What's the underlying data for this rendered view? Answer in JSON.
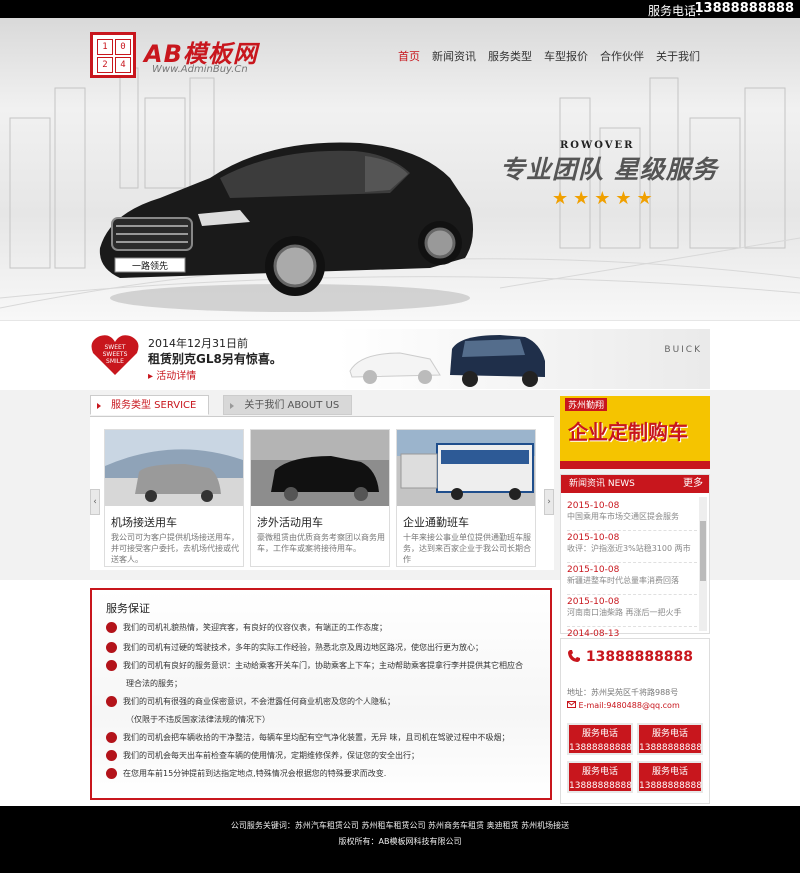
{
  "topbar": {
    "hotline_label": "服务电话：",
    "hotline_number": "13888888888"
  },
  "logo": {
    "digits": [
      "1",
      "0",
      "2",
      "4"
    ],
    "name": "AB模板网",
    "url": "Www.AdminBuy.Cn"
  },
  "nav": {
    "items": [
      "首页",
      "新闻资讯",
      "服务类型",
      "车型报价",
      "合作伙伴",
      "关于我们"
    ]
  },
  "hero": {
    "brand": "ROWOVER",
    "slogan": "专业团队 星级服务",
    "stars": "★★★★★",
    "plate": "一路领先"
  },
  "promo": {
    "heart_line1": "SWEET",
    "heart_line2": "SWEETS",
    "heart_line3": "SMILE",
    "title": "2014年12月31日前",
    "subtitle": "租赁别克GL8另有惊喜。",
    "link": "活动详情",
    "buick": "BUICK"
  },
  "services": {
    "tabs": [
      {
        "label": "服务类型 SERVICE"
      },
      {
        "label": "关于我们 ABOUT US"
      }
    ],
    "prev": "‹",
    "next": "›",
    "cards": [
      {
        "title": "机场接送用车",
        "desc": "我公司可为客户提供机场接送用车，并可接受客户委托，去机场代接或代送客人。"
      },
      {
        "title": "涉外活动用车",
        "desc": "豪微租赁由优质商务考察团以商务用车，工作车或案将接待用车。"
      },
      {
        "title": "企业通勤班车",
        "desc": "十年来接公事业单位提供通勤班车服务，达到来百家企业于我公司长期合作"
      }
    ]
  },
  "ad": {
    "label": "苏州勤翔",
    "main": "企业定制购车"
  },
  "news": {
    "heading": "新闻资讯 NEWS",
    "more": "更多",
    "items": [
      {
        "date": "2015-10-08",
        "title": "中国乘用车市场交通区提会服务"
      },
      {
        "date": "2015-10-08",
        "title": "收评：沪指涨近3%站稳3100 两市"
      },
      {
        "date": "2015-10-08",
        "title": "新疆进整车时代总量率消费回落"
      },
      {
        "date": "2015-10-08",
        "title": "河南南口油柴路 再涨后一把火手"
      },
      {
        "date": "2014-08-13",
        "title": ""
      }
    ]
  },
  "contact": {
    "phone": "13888888888",
    "address": "地址：苏州吴苑区千将路988号",
    "email": "E-mail:9480488@qq.com",
    "buttons": [
      {
        "label": "服务电话",
        "number": "13888888888"
      },
      {
        "label": "服务电话",
        "number": "13888888888"
      },
      {
        "label": "服务电话",
        "number": "13888888888"
      },
      {
        "label": "服务电话",
        "number": "13888888888"
      }
    ]
  },
  "guarantee": {
    "title": "服务保证",
    "items": [
      "我们的司机礼貌热情，笑迎宾客，有良好的仪容仪表，有端正的工作态度；",
      "我们的司机有过硬的驾驶技术，多年的实际工作经验，熟悉北京及周边地区路况，使您出行更为放心；",
      "我们的司机有良好的服务意识：主动给乘客开关车门，协助乘客上下车；主动帮助乘客提拿行李并提供其它相应合",
      "理合法的服务；",
      "我们的司机有很强的商业保密意识，不会泄露任何商业机密及您的个人隐私；",
      "（仅限于不违反国家法律法规的情况下）",
      "我们的司机会把车辆收拾的干净整洁，每辆车里均配有空气净化装置，无异 味，且司机在驾驶过程中不吸烟；",
      "我们的司机会每天出车前检查车辆的使用情况，定期维修保养，保证您的安全出行；",
      "在您用车前15分钟提前到达指定地点,特殊情况会根据您的特殊要求而改变."
    ]
  },
  "footer": {
    "keywords": "公司服务关键词：苏州汽车租赁公司 苏州租车租赁公司 苏州商务车租赁 奥迪租赁 苏州机场接送",
    "copyright": "版权所有：AB模板网科技有限公司"
  },
  "colors": {
    "accent": "#c8161d",
    "star": "#f0a000",
    "ad_bg": "#f5c400"
  }
}
